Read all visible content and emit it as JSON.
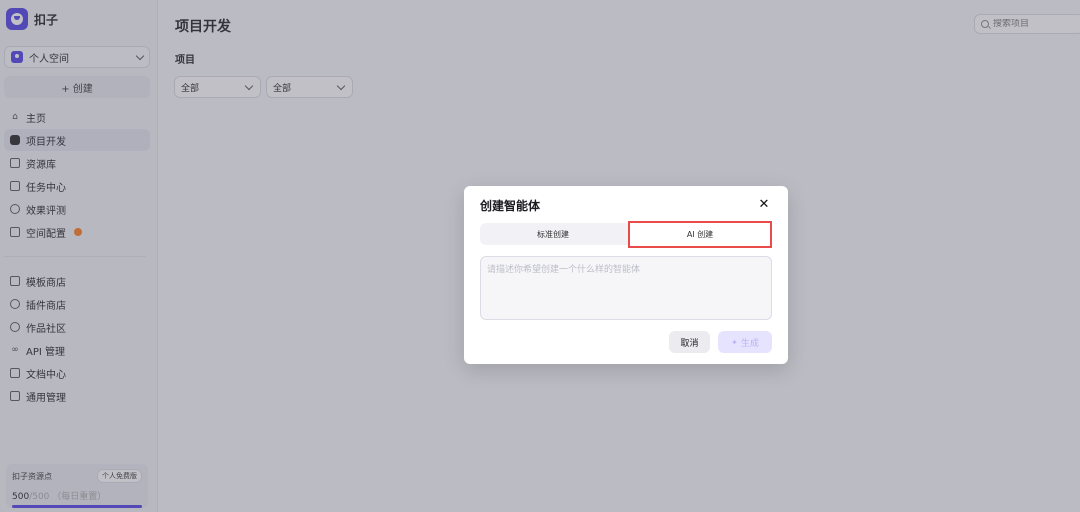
{
  "brand": {
    "name": "扣子"
  },
  "space": {
    "label": "个人空间"
  },
  "create": {
    "label": "+ 创建"
  },
  "nav_primary": [
    {
      "label": "主页",
      "icon": "home-icon"
    },
    {
      "label": "项目开发",
      "icon": "project-icon",
      "active": true
    },
    {
      "label": "资源库",
      "icon": "resource-icon"
    },
    {
      "label": "任务中心",
      "icon": "task-icon"
    },
    {
      "label": "效果评测",
      "icon": "evaluate-icon"
    },
    {
      "label": "空间配置",
      "icon": "config-icon",
      "warn": true
    }
  ],
  "nav_secondary": [
    {
      "label": "模板商店",
      "icon": "template-icon"
    },
    {
      "label": "插件商店",
      "icon": "plugin-icon"
    },
    {
      "label": "作品社区",
      "icon": "community-icon"
    },
    {
      "label": "API 管理",
      "icon": "api-icon"
    },
    {
      "label": "文档中心",
      "icon": "docs-icon"
    },
    {
      "label": "通用管理",
      "icon": "settings-icon"
    }
  ],
  "credits": {
    "label": "扣子资源点",
    "badge": "个人免费版",
    "current": "500",
    "total": "/500",
    "note": "（每日重置）",
    "fraction": 1.0
  },
  "main": {
    "title": "项目开发",
    "search_placeholder": "搜索项目",
    "section_label": "项目",
    "filters": [
      "全部",
      "全部"
    ]
  },
  "modal": {
    "title": "创建智能体",
    "close": "✕",
    "tab_standard": "标准创建",
    "tab_ai": "AI 创建",
    "prompt_placeholder": "请描述你希望创建一个什么样的智能体",
    "cancel": "取消",
    "generate": "生成"
  },
  "colors": {
    "accent": "#4e40e5",
    "highlight": "#e94a4a",
    "warning": "#ff7a1a"
  }
}
